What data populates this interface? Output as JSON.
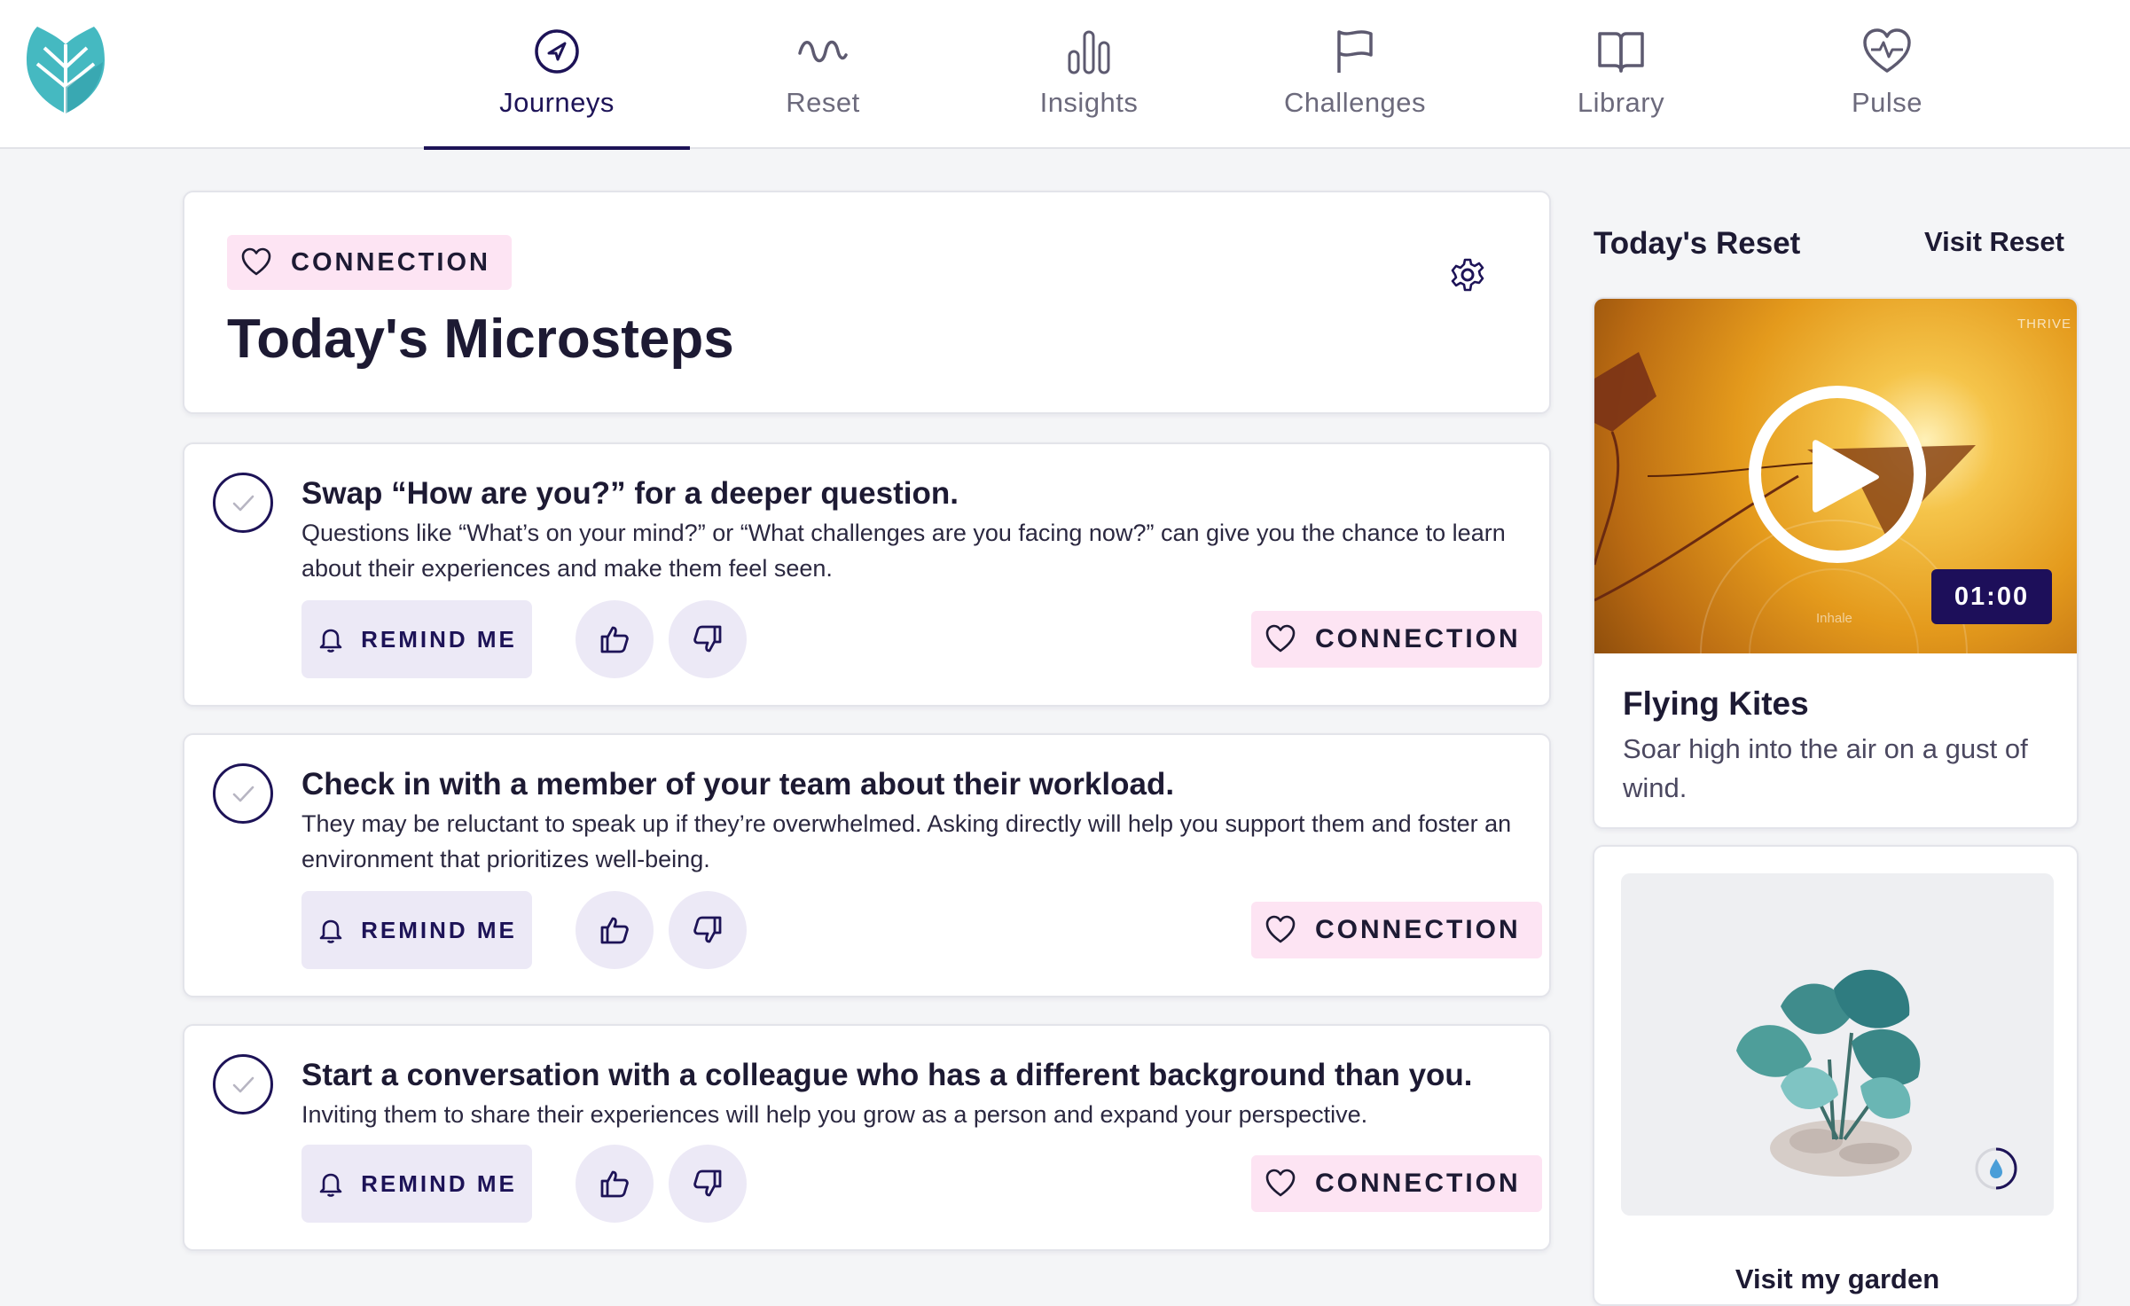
{
  "nav": {
    "items": [
      {
        "label": "Journeys",
        "icon": "compass-icon",
        "active": true
      },
      {
        "label": "Reset",
        "icon": "wave-icon"
      },
      {
        "label": "Insights",
        "icon": "bar-chart-icon"
      },
      {
        "label": "Challenges",
        "icon": "flag-icon"
      },
      {
        "label": "Library",
        "icon": "book-icon"
      },
      {
        "label": "Pulse",
        "icon": "heart-pulse-icon"
      }
    ]
  },
  "header": {
    "tag": "CONNECTION",
    "title": "Today's Microsteps"
  },
  "microsteps": [
    {
      "title": "Swap “How are you?” for a deeper question.",
      "description": "Questions like “What’s on your mind?” or “What challenges are you facing now?” can give you the chance to learn about their experiences and make them feel seen.",
      "remind_label": "REMIND ME",
      "tag": "CONNECTION"
    },
    {
      "title": "Check in with a member of your team about their workload.",
      "description": "They may be reluctant to speak up if they’re overwhelmed. Asking directly will help you support them and foster an environment that prioritizes well-being.",
      "remind_label": "REMIND ME",
      "tag": "CONNECTION"
    },
    {
      "title": "Start a conversation with a colleague who has a different background than you.",
      "description": "Inviting them to share their experiences will help you grow as a person and expand your perspective.",
      "remind_label": "REMIND ME",
      "tag": "CONNECTION"
    }
  ],
  "reset": {
    "heading": "Today's Reset",
    "link": "Visit Reset",
    "video": {
      "brand": "THRIVE",
      "overlay_text": "Inhale",
      "duration": "01:00",
      "title": "Flying Kites",
      "description": "Soar high into the air on a gust of wind."
    }
  },
  "garden": {
    "link": "Visit my garden"
  },
  "colors": {
    "accent": "#1d1357",
    "tag_bg": "#fde4f3",
    "button_bg": "#ece9f6",
    "logo_teal": "#3fb3bd"
  }
}
